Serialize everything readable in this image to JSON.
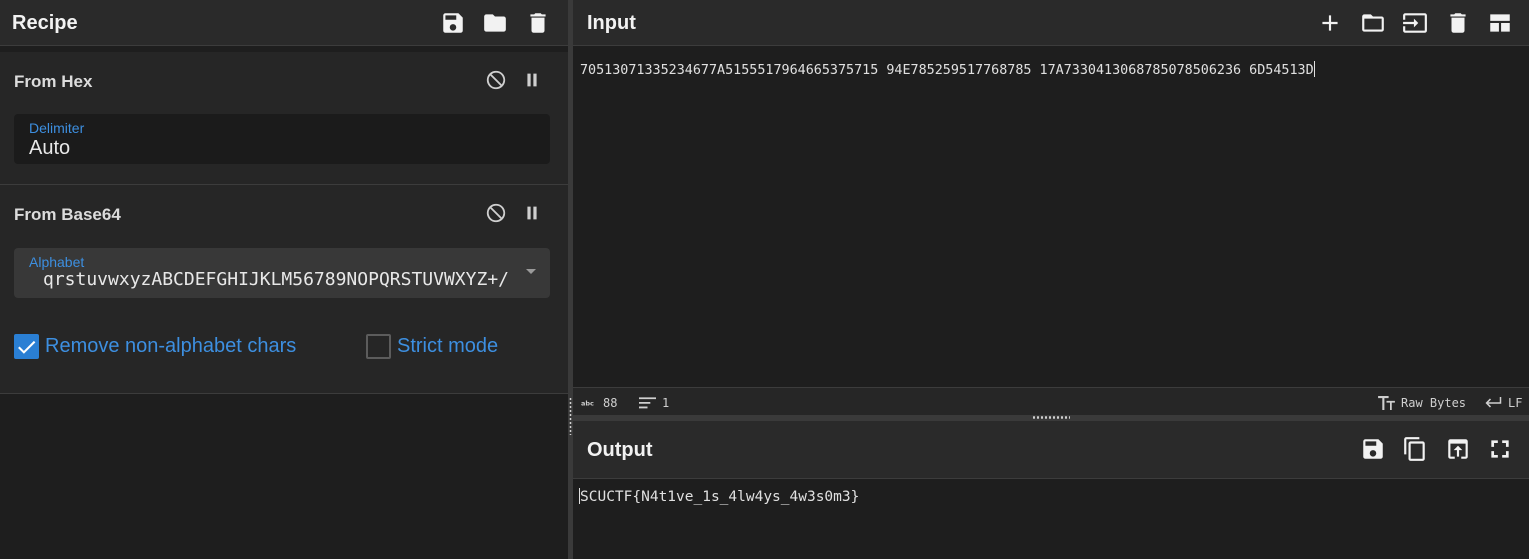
{
  "recipe": {
    "title": "Recipe",
    "header_icons": [
      "save-icon",
      "folder-icon",
      "trash-icon"
    ],
    "operations": [
      {
        "name": "From Hex",
        "delimiter_label": "Delimiter",
        "delimiter_value": "Auto"
      },
      {
        "name": "From Base64",
        "alphabet_label": "Alphabet",
        "alphabet_value": "qrstuvwxyzABCDEFGHIJKLM56789NOPQRSTUVWXYZ+/",
        "remove_non_alphabet_label": "Remove non-alphabet chars",
        "remove_non_alphabet_checked": true,
        "strict_mode_label": "Strict mode",
        "strict_mode_checked": false
      }
    ]
  },
  "input": {
    "title": "Input",
    "header_icons": [
      "plus-icon",
      "folder-icon",
      "import-icon",
      "trash-icon",
      "layout-icon"
    ],
    "text": "70513071335234677A5155517964665375715 94E785259517768785 17A7330413068785078506236 6D54513D",
    "status": {
      "length_label": "88",
      "lines_label": "1",
      "encoding_label": "Raw Bytes",
      "eol_label": "LF"
    }
  },
  "output": {
    "title": "Output",
    "header_icons": [
      "save-icon",
      "copy-icon",
      "replace-input-icon",
      "maximize-icon"
    ],
    "text": "SCUCTF{N4t1ve_1s_4lw4ys_4w3s0m3}"
  },
  "colors": {
    "accent": "#2a7fd4",
    "label_blue": "#3d8fe0",
    "background": "#1e1e1e",
    "header": "#2a2a2a"
  }
}
